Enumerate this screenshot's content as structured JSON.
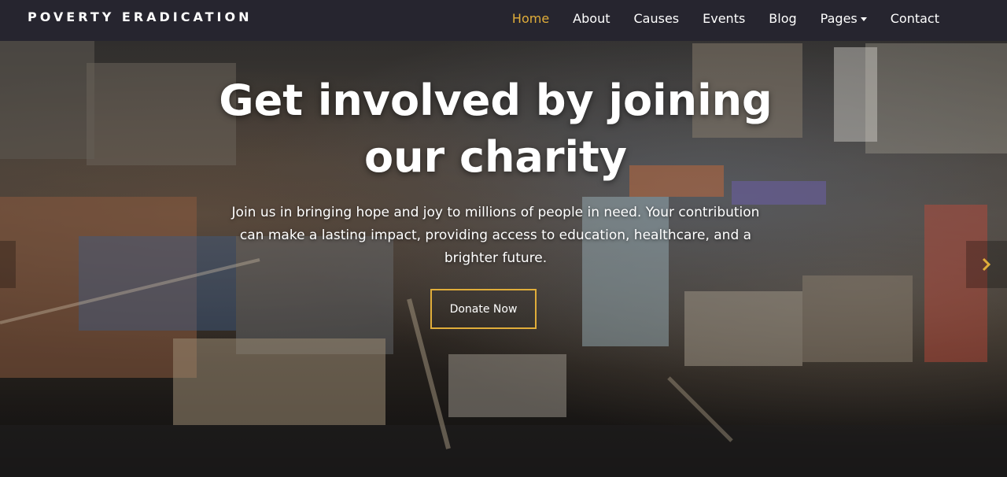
{
  "brand": {
    "name": "POVERTY ERADICATION"
  },
  "nav": {
    "items": [
      {
        "label": "Home",
        "active": true
      },
      {
        "label": "About"
      },
      {
        "label": "Causes"
      },
      {
        "label": "Events"
      },
      {
        "label": "Blog"
      },
      {
        "label": "Pages",
        "dropdown": true
      },
      {
        "label": "Contact"
      }
    ]
  },
  "hero": {
    "headline": "Get involved by joining our charity",
    "subtext": "Join us in bringing hope and joy to millions of people in need. Your contribution can make a lasting impact, providing access to education, healthcare, and a brighter future.",
    "cta_label": "Donate Now",
    "background_image": "slum-shacks-photo"
  },
  "carousel": {
    "next_icon": "chevron-right-icon",
    "prev_icon": "chevron-left-icon"
  },
  "colors": {
    "navbar_bg": "#26252f",
    "accent": "#e0ad3a",
    "text": "#ffffff"
  }
}
